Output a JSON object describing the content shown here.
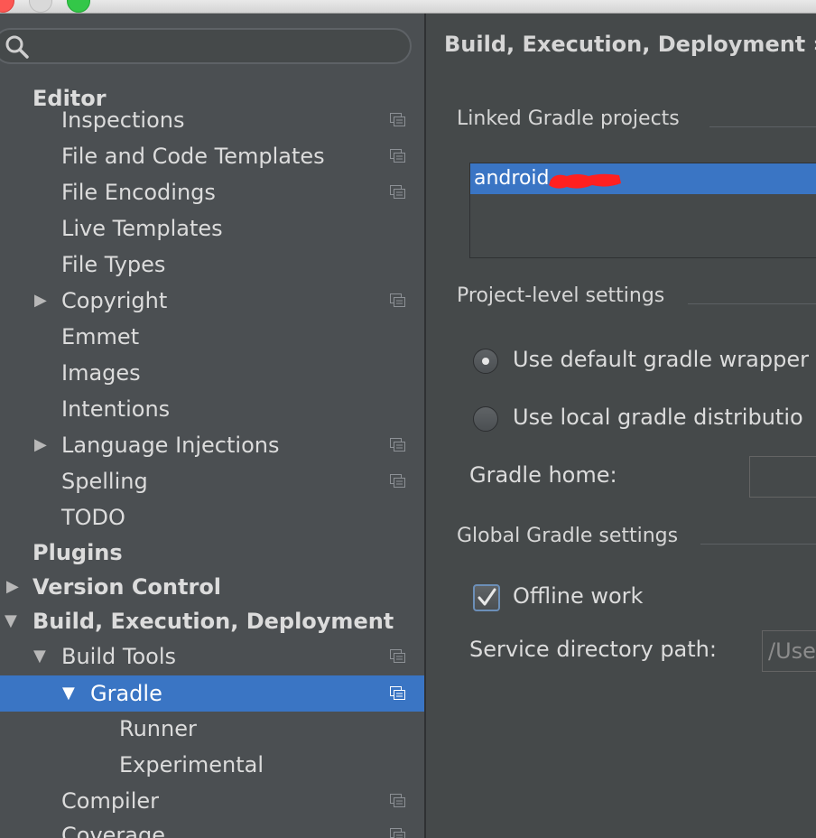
{
  "window": {
    "controls": [
      "close",
      "minimize",
      "zoom"
    ]
  },
  "search": {
    "placeholder": "",
    "value": ""
  },
  "tree": {
    "items": [
      {
        "label": "Editor",
        "bold": true,
        "expandable": false,
        "copy_icon": false
      },
      {
        "label": "Inspections",
        "copy_icon": true
      },
      {
        "label": "File and Code Templates",
        "copy_icon": true
      },
      {
        "label": "File Encodings",
        "copy_icon": true
      },
      {
        "label": "Live Templates",
        "copy_icon": false
      },
      {
        "label": "File Types",
        "copy_icon": false
      },
      {
        "label": "Copyright",
        "arrow": "collapsed",
        "copy_icon": true
      },
      {
        "label": "Emmet",
        "copy_icon": false
      },
      {
        "label": "Images",
        "copy_icon": false
      },
      {
        "label": "Intentions",
        "copy_icon": false
      },
      {
        "label": "Language Injections",
        "arrow": "collapsed",
        "copy_icon": true
      },
      {
        "label": "Spelling",
        "copy_icon": true
      },
      {
        "label": "TODO",
        "copy_icon": false
      },
      {
        "label": "Plugins",
        "bold": true,
        "copy_icon": false
      },
      {
        "label": "Version Control",
        "bold": true,
        "arrow": "collapsed",
        "copy_icon": false
      },
      {
        "label": "Build, Execution, Deployment",
        "bold": true,
        "arrow": "expanded",
        "copy_icon": false
      },
      {
        "label": "Build Tools",
        "arrow": "expanded",
        "copy_icon": true
      },
      {
        "label": "Gradle",
        "arrow": "expanded",
        "copy_icon": true,
        "selected": true
      },
      {
        "label": "Runner",
        "copy_icon": false
      },
      {
        "label": "Experimental",
        "copy_icon": false
      },
      {
        "label": "Compiler",
        "copy_icon": true
      },
      {
        "label": "Coverage",
        "copy_icon": true
      }
    ]
  },
  "content": {
    "breadcrumb": "Build, Execution, Deployment ›",
    "linked_section_title": "Linked Gradle projects",
    "linked_projects": [
      "android"
    ],
    "project_section_title": "Project-level settings",
    "radio_options": [
      {
        "label": "Use default gradle wrapper",
        "selected": true
      },
      {
        "label": "Use local gradle distributio",
        "selected": false
      }
    ],
    "gradle_home_label": "Gradle home:",
    "gradle_home_value": "",
    "global_section_title": "Global Gradle settings",
    "offline_work_label": "Offline work",
    "offline_work_checked": true,
    "service_dir_label": "Service directory path:",
    "service_dir_value": "/Use"
  },
  "colors": {
    "selection": "#3a75c4",
    "tree_bg": "#4b4f52",
    "panel_bg": "#45494a",
    "text": "#dcdcdc",
    "redaction": "#ff2020"
  }
}
